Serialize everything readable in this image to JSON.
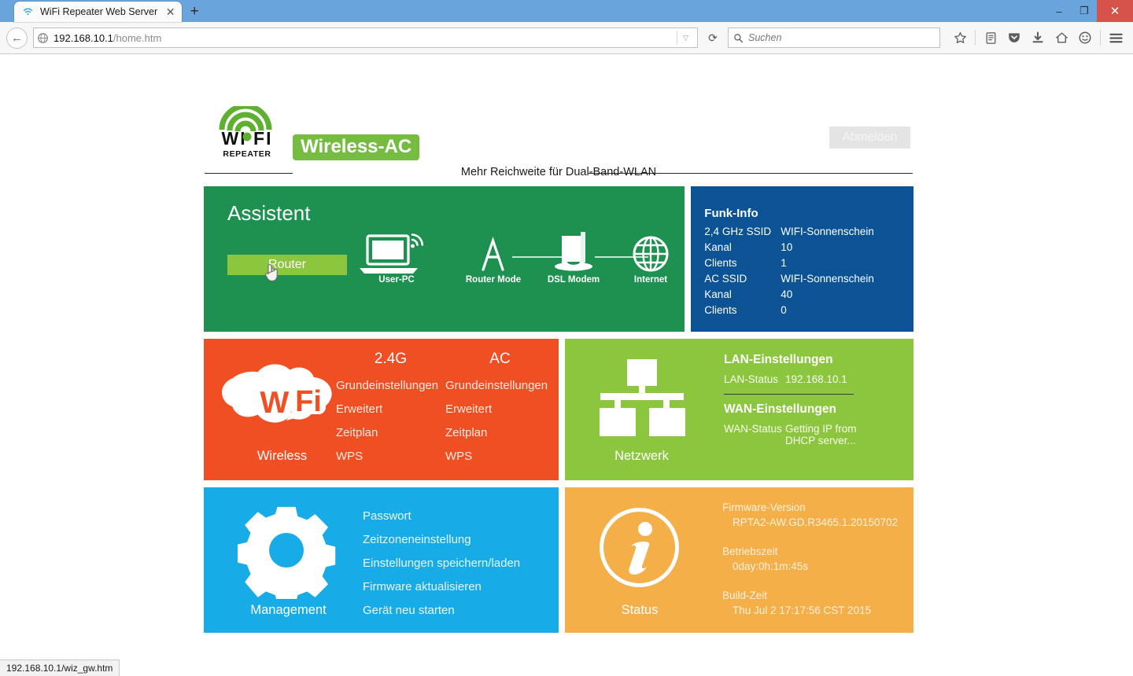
{
  "browser": {
    "tab": {
      "title": "WiFi Repeater Web Server",
      "favicon_icon": "wifi-icon",
      "close_icon": "✕"
    },
    "new_tab_label": "+",
    "window_controls": {
      "minimize": "–",
      "maximize": "❐",
      "close": "✕"
    },
    "back_icon": "←",
    "url_host": "192.168.10.1",
    "url_path": "/home.htm",
    "url_dropdown_icon": "▽",
    "reload_icon": "⟳",
    "search_placeholder": "Suchen",
    "toolbar_icons": [
      "bookmark-star-icon",
      "reader-list-icon",
      "pocket-icon",
      "downloads-icon",
      "home-icon",
      "sync-chat-icon",
      "hamburger-menu-icon"
    ],
    "status_link": "192.168.10.1/wiz_gw.htm"
  },
  "header": {
    "logo_text": "WI FI",
    "logo_sub": "REPEATER",
    "brand": "Wireless-AC",
    "tagline": "Mehr Reichweite für Dual-Band-WLAN",
    "logout": "Abmelden"
  },
  "assistent": {
    "title": "Assistent",
    "router_button": "Router",
    "nodes": [
      {
        "label": "User-PC",
        "icon": "laptop-wifi-icon"
      },
      {
        "label": "Router Mode",
        "icon": "antenna-icon"
      },
      {
        "label": "DSL Modem",
        "icon": "modem-icon"
      },
      {
        "label": "Internet",
        "icon": "globe-icon"
      }
    ]
  },
  "funk_info": {
    "title": "Funk-Info",
    "rows": [
      {
        "key": "2,4 GHz SSID",
        "value": "WIFI-Sonnenschein"
      },
      {
        "key": "Kanal",
        "value": "10"
      },
      {
        "key": "Clients",
        "value": "1"
      },
      {
        "key": "AC SSID",
        "value": "WIFI-Sonnenschein"
      },
      {
        "key": "Kanal",
        "value": "40"
      },
      {
        "key": "Clients",
        "value": "0"
      }
    ]
  },
  "wireless": {
    "caption": "Wireless",
    "icon": "wifi-cloud-icon",
    "columns": [
      {
        "header": "2.4G",
        "links": [
          "Grundeinstellungen",
          "Erweitert",
          "Zeitplan",
          "WPS"
        ]
      },
      {
        "header": "AC",
        "links": [
          "Grundeinstellungen",
          "Erweitert",
          "Zeitplan",
          "WPS"
        ]
      }
    ]
  },
  "netzwerk": {
    "caption": "Netzwerk",
    "icon": "network-tree-icon",
    "lan_heading": "LAN-Einstellungen",
    "lan_key": "LAN-Status",
    "lan_value": "192.168.10.1",
    "wan_heading": "WAN-Einstellungen",
    "wan_key": "WAN-Status",
    "wan_value": "Getting IP from DHCP server..."
  },
  "management": {
    "caption": "Management",
    "icon": "gear-icon",
    "links": [
      "Passwort",
      "Zeitzoneneinstellung",
      "Einstellungen speichern/laden",
      "Firmware aktualisieren",
      "Gerät neu starten"
    ]
  },
  "status": {
    "caption": "Status",
    "icon": "info-circle-icon",
    "firmware_key": "Firmware-Version",
    "firmware_value": "RPTA2-AW.GD.R3465.1.20150702",
    "uptime_key": "Betriebszeit",
    "uptime_value": "0day:0h:1m:45s",
    "build_key": "Build-Zeit",
    "build_value": "Thu Jul 2 17:17:56 CST 2015"
  },
  "colors": {
    "green": "#1E9050",
    "light_green": "#8CC63E",
    "blue": "#0B5394",
    "orange_red": "#F04E23",
    "cyan": "#17ACE8",
    "amber": "#F5AF48",
    "brand_green": "#76BC43"
  }
}
